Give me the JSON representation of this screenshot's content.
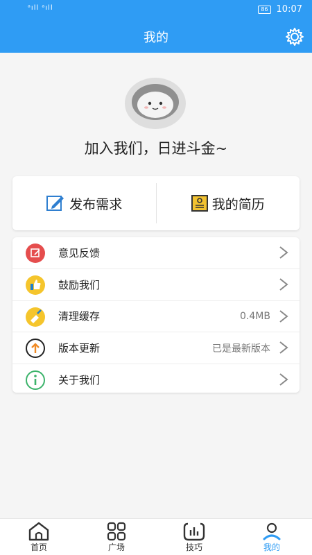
{
  "status": {
    "signal": "ᵃıll ᵃıll",
    "battery": "86",
    "time": "10:07"
  },
  "header": {
    "title": "我的"
  },
  "profile": {
    "slogan": "加入我们，日进斗金~"
  },
  "actions": [
    {
      "label": "发布需求",
      "icon": "edit-icon"
    },
    {
      "label": "我的简历",
      "icon": "resume-icon"
    }
  ],
  "menu": [
    {
      "label": "意见反馈",
      "value": "",
      "icon": "feedback-icon",
      "color": "#e54d4d"
    },
    {
      "label": "鼓励我们",
      "value": "",
      "icon": "thumbs-up-icon",
      "color": "#f5c52c"
    },
    {
      "label": "清理缓存",
      "value": "0.4MB",
      "icon": "broom-icon",
      "color": "#f5c52c"
    },
    {
      "label": "版本更新",
      "value": "已是最新版本",
      "icon": "upload-icon",
      "color": "#f08a24"
    },
    {
      "label": "关于我们",
      "value": "",
      "icon": "info-icon",
      "color": "#3bb36a"
    }
  ],
  "tabs": [
    {
      "label": "首页",
      "icon": "home-icon",
      "active": false
    },
    {
      "label": "广场",
      "icon": "grid-icon",
      "active": false
    },
    {
      "label": "技巧",
      "icon": "chart-icon",
      "active": false
    },
    {
      "label": "我的",
      "icon": "user-icon",
      "active": true
    }
  ],
  "colors": {
    "primary": "#2f9cf4"
  }
}
